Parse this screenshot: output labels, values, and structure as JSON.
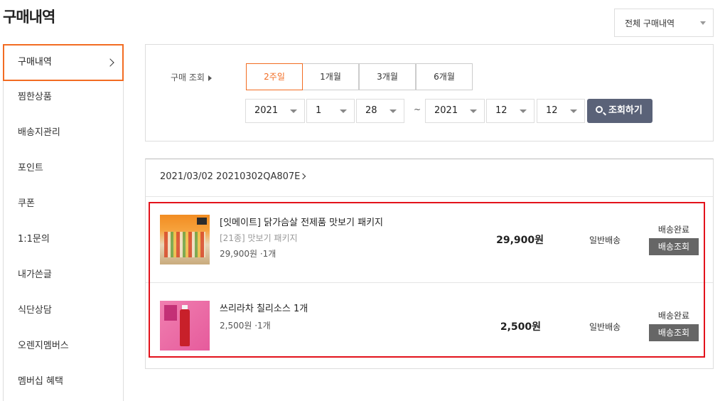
{
  "page": {
    "title": "구매내역"
  },
  "top_select": {
    "value": "전체 구매내역"
  },
  "sidebar": {
    "items": [
      {
        "label": "구매내역",
        "active": true
      },
      {
        "label": "찜한상품"
      },
      {
        "label": "배송지관리"
      },
      {
        "label": "포인트"
      },
      {
        "label": "쿠폰"
      },
      {
        "label": "1:1문의"
      },
      {
        "label": "내가쓴글"
      },
      {
        "label": "식단상담"
      },
      {
        "label": "오렌지멤버스"
      },
      {
        "label": "멤버십 혜택"
      }
    ]
  },
  "filter": {
    "label": "구매 조회",
    "periods": [
      "2주일",
      "1개월",
      "3개월",
      "6개월"
    ],
    "active_period": "2주일",
    "from": {
      "year": "2021",
      "month": "1",
      "day": "28"
    },
    "separator": "~",
    "to": {
      "year": "2021",
      "month": "12",
      "day": "12"
    },
    "search_label": "조회하기"
  },
  "order": {
    "header": "2021/03/02 20210302QA807E",
    "items": [
      {
        "name": "[잇메이트] 닭가슴살 전제품 맛보기 패키지",
        "option": "[21종] 맛보기 패키지",
        "price_qty": "29,900원 ·1개",
        "price": "29,900원",
        "shipping": "일반배송",
        "status": "배송완료",
        "track_label": "배송조회"
      },
      {
        "name": "쓰리라차 칠리소스 1개",
        "option": "",
        "price_qty": "2,500원 ·1개",
        "price": "2,500원",
        "shipping": "일반배송",
        "status": "배송완료",
        "track_label": "배송조회"
      }
    ]
  },
  "colors": {
    "accent": "#f26c22",
    "search_button": "#5a6278",
    "highlight": "#e3121b",
    "track_button": "#666666"
  }
}
